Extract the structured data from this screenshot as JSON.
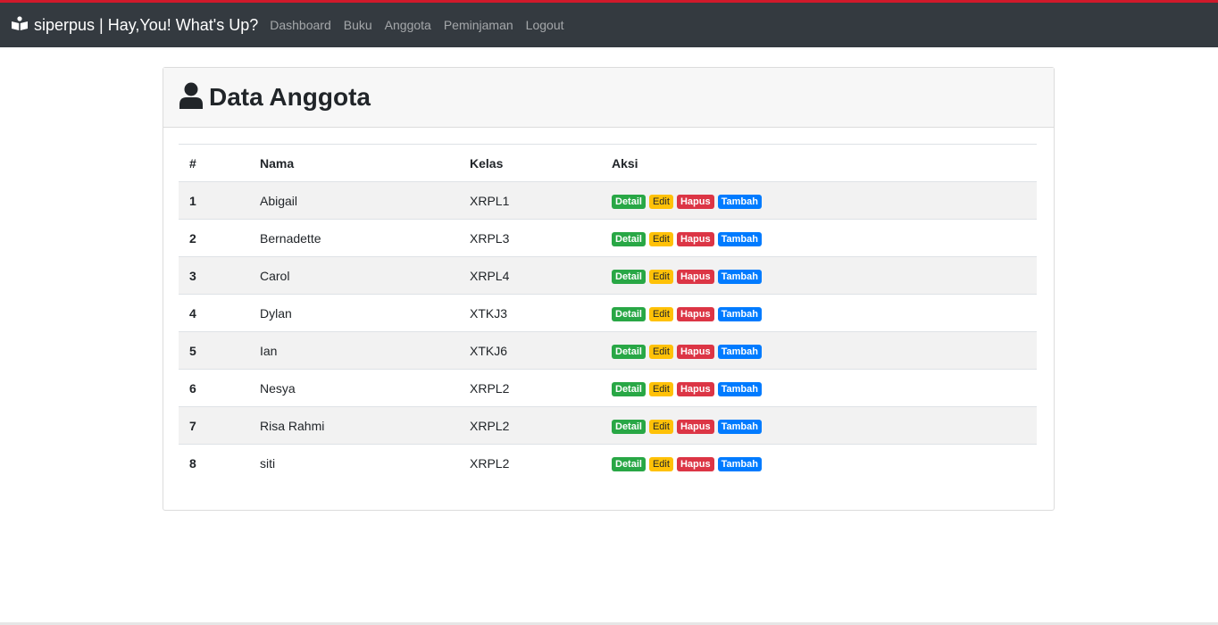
{
  "nav": {
    "brand": "siperpus | Hay,You! What's Up?",
    "links": [
      "Dashboard",
      "Buku",
      "Anggota",
      "Peminjaman",
      "Logout"
    ]
  },
  "card": {
    "title": "Data Anggota"
  },
  "table": {
    "headers": [
      "#",
      "Nama",
      "Kelas",
      "Aksi"
    ],
    "actions": [
      "Detail",
      "Edit",
      "Hapus",
      "Tambah"
    ],
    "rows": [
      {
        "no": "1",
        "nama": "Abigail",
        "kelas": "XRPL1"
      },
      {
        "no": "2",
        "nama": "Bernadette",
        "kelas": "XRPL3"
      },
      {
        "no": "3",
        "nama": "Carol",
        "kelas": "XRPL4"
      },
      {
        "no": "4",
        "nama": "Dylan",
        "kelas": "XTKJ3"
      },
      {
        "no": "5",
        "nama": "Ian",
        "kelas": "XTKJ6"
      },
      {
        "no": "6",
        "nama": "Nesya",
        "kelas": "XRPL2"
      },
      {
        "no": "7",
        "nama": "Risa Rahmi",
        "kelas": "XRPL2"
      },
      {
        "no": "8",
        "nama": "siti",
        "kelas": "XRPL2"
      }
    ]
  }
}
